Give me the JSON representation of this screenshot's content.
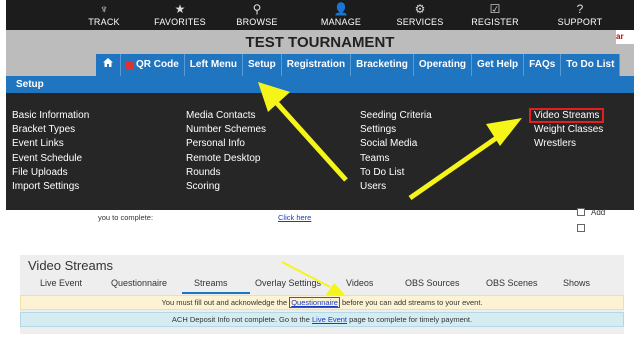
{
  "topnav": {
    "items": [
      {
        "icon": "♆",
        "icon_name": "track-icon",
        "label": "TRACK"
      },
      {
        "icon": "★",
        "icon_name": "favorites-icon",
        "label": "FAVORITES"
      },
      {
        "icon": "⚲",
        "icon_name": "search-icon",
        "label": "BROWSE"
      },
      {
        "icon": "👤",
        "icon_name": "user-icon",
        "label": "MANAGE"
      },
      {
        "icon": "⚙",
        "icon_name": "gear-icon",
        "label": "SERVICES"
      },
      {
        "icon": "☑",
        "icon_name": "register-icon",
        "label": "REGISTER"
      },
      {
        "icon": "?",
        "icon_name": "help-icon",
        "label": "SUPPORT"
      }
    ]
  },
  "title": "TEST TOURNAMENT",
  "corner_text": "ar",
  "tabs": [
    "QR Code",
    "Left Menu",
    "Setup",
    "Registration",
    "Bracketing",
    "Operating",
    "Get Help",
    "FAQs",
    "To Do List"
  ],
  "setup_header": "Setup",
  "menu": {
    "col1": [
      "Basic Information",
      "Bracket Types",
      "Event Links",
      "Event Schedule",
      "File Uploads",
      "Import Settings"
    ],
    "col2": [
      "Media Contacts",
      "Number Schemes",
      "Personal Info",
      "Remote Desktop",
      "Rounds",
      "Scoring"
    ],
    "col3": [
      "Seeding Criteria",
      "Settings",
      "Social Media",
      "Teams",
      "To Do List",
      "Users"
    ],
    "col4": [
      "Video Streams",
      "Weight Classes",
      "Wrestlers"
    ]
  },
  "below": {
    "text": "you to complete:",
    "link": "Click here",
    "right_label": "Add"
  },
  "video_streams": {
    "title": "Video Streams",
    "tabs": [
      "Live Event",
      "Questionnaire",
      "Streams",
      "Overlay Settings",
      "Videos",
      "OBS Sources",
      "OBS Scenes",
      "Shows"
    ],
    "notice1_before": "You must fill out and acknowledge the ",
    "notice1_link": "Questionnaire",
    "notice1_after": " before you can add streams to your event.",
    "notice2_before": "ACH Deposit Info not complete. Go to the ",
    "notice2_link": "Live Event",
    "notice2_after": " page to complete for timely payment."
  },
  "colors": {
    "nav_dark": "#1c1c1c",
    "tab_blue": "#1f75c0",
    "panel_dark": "#262626",
    "highlight_red": "#e02020",
    "arrow_yellow": "#f5f51a"
  }
}
